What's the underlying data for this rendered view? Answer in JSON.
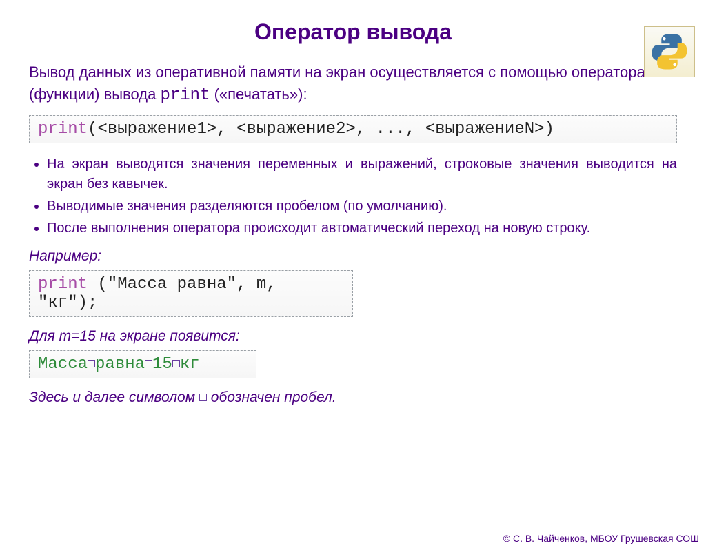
{
  "title": "Оператор вывода",
  "intro": {
    "line1": "Вывод данных из оперативной памяти на экран осуществляется с помощью оператора (функции) вывода ",
    "kw": "print",
    "line2": " («печатать»):"
  },
  "syntax": {
    "kw": "print",
    "rest": "(<выражение1>, <выражение2>, ..., <выражениеN>)"
  },
  "bullets": [
    "На экран выводятся значения переменных и выражений, строковые значения выводится на экран без кавычек.",
    "Выводимые значения разделяются пробелом (по умолчанию).",
    "После выполнения оператора происходит автоматический переход на новую строку."
  ],
  "example_label": "Например:",
  "example_code": {
    "kw": "print",
    "rest": " (\"Масса равна\", m, \"кг\");"
  },
  "example_run_label": "Для m=15 на экране появится:",
  "output_tokens": [
    "Масса",
    "равна",
    "15",
    "кг"
  ],
  "note_parts": {
    "a": "Здесь и далее символом ",
    "b": " обозначен пробел."
  },
  "footer": "©   С. В. Чайченков, МБОУ Грушевская СОШ"
}
